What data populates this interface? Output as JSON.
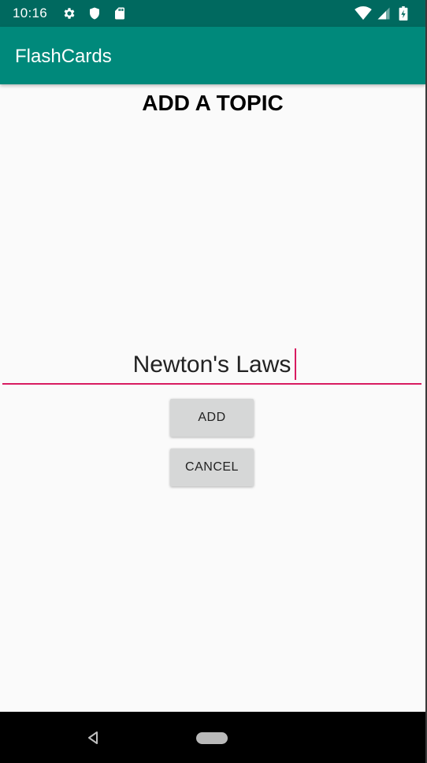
{
  "status_bar": {
    "time": "10:16",
    "left_icons": [
      "settings-icon",
      "shield-icon",
      "sd-card-icon"
    ],
    "right_icons": [
      "wifi-icon",
      "cell-signal-icon",
      "battery-icon"
    ],
    "color": "#00695f"
  },
  "app_bar": {
    "title": "FlashCards",
    "color": "#00897b"
  },
  "main": {
    "heading": "ADD A TOPIC",
    "topic_input": {
      "value": "Newton's Laws",
      "underline_color": "#d81b60"
    },
    "add_button": "ADD",
    "cancel_button": "CANCEL"
  },
  "nav_bar": {
    "icons": [
      "back-icon",
      "home-pill-icon"
    ]
  }
}
